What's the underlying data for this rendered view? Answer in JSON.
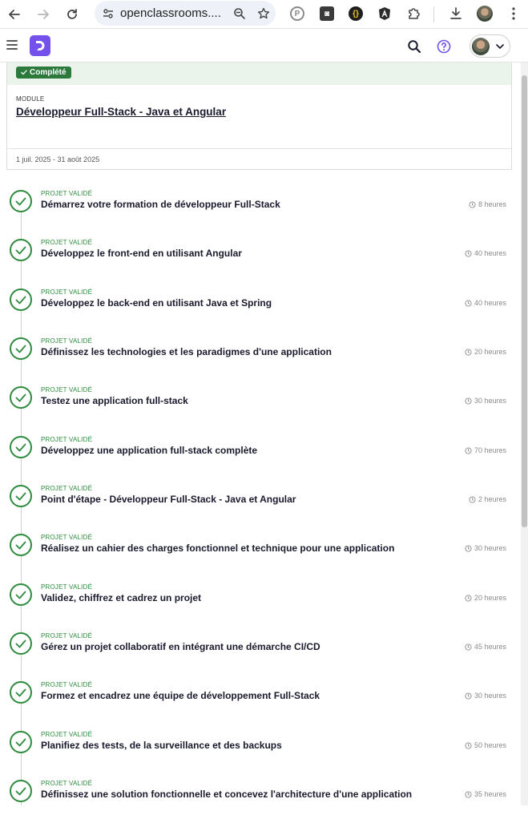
{
  "browser": {
    "url": "openclassrooms....",
    "extensions": [
      "p-circle-icon",
      "camera-extension-icon",
      "braces-extension-icon",
      "angular-extension-icon",
      "puzzle-icon"
    ]
  },
  "module": {
    "badge": "Complété",
    "kicker": "MODULE",
    "title": "Développeur Full-Stack - Java et Angular",
    "dates": "1 juil. 2025 - 31 août 2025"
  },
  "projects": [
    {
      "status": "PROJET VALIDÉ",
      "title": "Démarrez votre formation de développeur Full-Stack",
      "duration": "8 heures"
    },
    {
      "status": "PROJET VALIDÉ",
      "title": "Développez le front-end en utilisant Angular",
      "duration": "40 heures"
    },
    {
      "status": "PROJET VALIDÉ",
      "title": "Développez le back-end en utilisant Java et Spring",
      "duration": "40 heures"
    },
    {
      "status": "PROJET VALIDÉ",
      "title": "Définissez les technologies et les paradigmes d'une application",
      "duration": "20 heures"
    },
    {
      "status": "PROJET VALIDÉ",
      "title": "Testez une application full-stack",
      "duration": "30 heures"
    },
    {
      "status": "PROJET VALIDÉ",
      "title": "Développez une application full-stack complète",
      "duration": "70 heures"
    },
    {
      "status": "PROJET VALIDÉ",
      "title": "Point d'étape - Développeur Full-Stack - Java et Angular",
      "duration": "2 heures"
    },
    {
      "status": "PROJET VALIDÉ",
      "title": "Réalisez un cahier des charges fonctionnel et technique pour une application",
      "duration": "30 heures"
    },
    {
      "status": "PROJET VALIDÉ",
      "title": "Validez, chiffrez et cadrez un projet",
      "duration": "20 heures"
    },
    {
      "status": "PROJET VALIDÉ",
      "title": "Gérez un projet collaboratif en intégrant une démarche CI/CD",
      "duration": "45 heures"
    },
    {
      "status": "PROJET VALIDÉ",
      "title": "Formez et encadrez une équipe de développement Full-Stack",
      "duration": "30 heures"
    },
    {
      "status": "PROJET VALIDÉ",
      "title": "Planifiez des tests, de la surveillance et des backups",
      "duration": "50 heures"
    },
    {
      "status": "PROJET VALIDÉ",
      "title": "Définissez une solution fonctionnelle et concevez l'architecture d'une application",
      "duration": "35 heures"
    }
  ],
  "colors": {
    "brand": "#7451eb",
    "success": "#2e8b3e",
    "badge": "#2c7a3b"
  }
}
